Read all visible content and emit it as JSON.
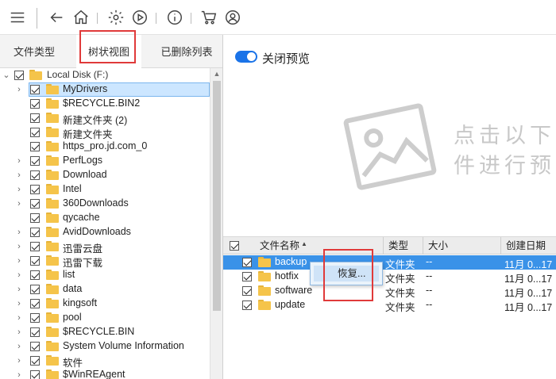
{
  "toolbar": {
    "icons": [
      "menu-icon",
      "back-icon",
      "home-icon",
      "settings-icon",
      "play-icon",
      "info-icon",
      "cart-icon",
      "user-icon"
    ]
  },
  "tabs": [
    {
      "label": "文件类型",
      "active": false
    },
    {
      "label": "树状视图",
      "active": true
    },
    {
      "label": "已删除列表",
      "active": false
    }
  ],
  "tree": {
    "root": "Local Disk (F:)",
    "items": [
      {
        "label": "MyDrivers",
        "expandable": true,
        "selected": true
      },
      {
        "label": "$RECYCLE.BIN2",
        "expandable": false
      },
      {
        "label": "新建文件夹 (2)",
        "expandable": false
      },
      {
        "label": "新建文件夹",
        "expandable": false
      },
      {
        "label": "https_pro.jd.com_0",
        "expandable": false
      },
      {
        "label": "PerfLogs",
        "expandable": true
      },
      {
        "label": "Download",
        "expandable": true
      },
      {
        "label": "Intel",
        "expandable": true
      },
      {
        "label": "360Downloads",
        "expandable": true
      },
      {
        "label": "qycache",
        "expandable": false
      },
      {
        "label": "AvidDownloads",
        "expandable": true
      },
      {
        "label": "迅雷云盘",
        "expandable": true
      },
      {
        "label": "迅雷下载",
        "expandable": true
      },
      {
        "label": "list",
        "expandable": true
      },
      {
        "label": "data",
        "expandable": true
      },
      {
        "label": "kingsoft",
        "expandable": true
      },
      {
        "label": "pool",
        "expandable": true
      },
      {
        "label": "$RECYCLE.BIN",
        "expandable": true
      },
      {
        "label": "System Volume Information",
        "expandable": true
      },
      {
        "label": "软件",
        "expandable": true
      },
      {
        "label": "$WinREAgent",
        "expandable": true
      }
    ]
  },
  "preview": {
    "toggle_label": "关闭预览",
    "toggle_on": true,
    "hint_line1": "点击以下",
    "hint_line2": "件进行预"
  },
  "table": {
    "headers": [
      "文件名称",
      "类型",
      "大小",
      "创建日期"
    ],
    "rows": [
      {
        "name": "backup",
        "type": "文件夹",
        "size": "--",
        "date": "11月 0...17",
        "selected": true
      },
      {
        "name": "hotfix",
        "type": "文件夹",
        "size": "--",
        "date": "11月 0...17",
        "selected": false
      },
      {
        "name": "software",
        "type": "文件夹",
        "size": "--",
        "date": "11月 0...17",
        "selected": false
      },
      {
        "name": "update",
        "type": "文件夹",
        "size": "--",
        "date": "11月 0...17",
        "selected": false
      }
    ]
  },
  "context_menu": {
    "item": "恢复..."
  },
  "colors": {
    "accent": "#1a73e8",
    "selection": "#3a92e8",
    "highlight_box": "#e03a3a",
    "folder": "#f5c44a"
  }
}
